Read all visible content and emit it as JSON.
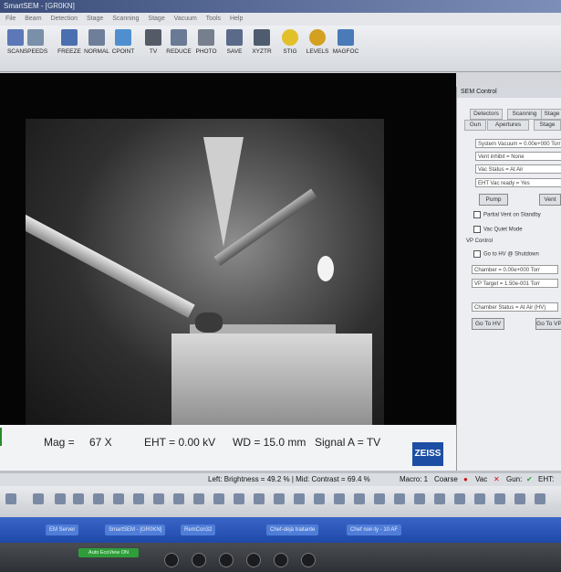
{
  "window": {
    "title": "SmartSEM - [GR0KN]"
  },
  "menu": [
    "File",
    "Beam",
    "Detection",
    "Stage",
    "Scanning",
    "Stage",
    "Vacuum",
    "Tools",
    "Help"
  ],
  "toolbar": [
    {
      "label": "SCAN",
      "icon": "scan-icon",
      "color": "#5c78b8"
    },
    {
      "label": "SPEEDS",
      "icon": "speeds-icon",
      "color": "#7a8fa8"
    },
    {
      "label": "FREEZE",
      "icon": "freeze-icon",
      "color": "#4a6fb0"
    },
    {
      "label": "NORMAL",
      "icon": "normal-icon",
      "color": "#6f7f9a"
    },
    {
      "label": "CPOINT",
      "icon": "cpoint-icon",
      "color": "#4f8fd0"
    },
    {
      "label": "TV",
      "icon": "tv-icon",
      "color": "#555b66"
    },
    {
      "label": "REDUCE",
      "icon": "reduce-icon",
      "color": "#6a7a94"
    },
    {
      "label": "PHOTO",
      "icon": "photo-icon",
      "color": "#777f8c"
    },
    {
      "label": "SAVE",
      "icon": "save-icon",
      "color": "#5a6a88"
    },
    {
      "label": "XYZTR",
      "icon": "xyztr-icon",
      "color": "#4f5b6e"
    },
    {
      "label": "STIG",
      "icon": "stig-icon",
      "color": "#e2c02a"
    },
    {
      "label": "LEVELS",
      "icon": "levels-icon",
      "color": "#d4a020"
    },
    {
      "label": "MAGFOC",
      "icon": "magfoc-icon",
      "color": "#4a7ab8"
    }
  ],
  "status": {
    "mag": "Mag =",
    "mag_value": "67 X",
    "eht": "EHT = 0.00 kV",
    "wd": "WD = 15.0 mm",
    "signal": "Signal A = TV",
    "brand": "ZEISS"
  },
  "panel": {
    "title": "SEM Control",
    "tabs_row1": [
      "Detectors",
      "Scanning",
      "Stage"
    ],
    "tabs_row2": [
      "Gun",
      "Apertures",
      "Stage"
    ],
    "system_vacuum": "System Vacuum = 0.00e+000 Torr",
    "vent_inhibit": "Vent inhibit = None",
    "vac_status": "Vac Status = At Air",
    "eht_vac_ready": "EHT Vac ready = Yes",
    "pump_label": "Pump",
    "vent_label": "Vent",
    "partial_vent": "Partial Vent on Standby",
    "vac_quiet": "Vac Quiet Mode",
    "vp_control": "VP Control",
    "go_hv_shutdown": "Go to HV @ Shutdown",
    "chamber": "Chamber = 0.00e+000 Torr",
    "vp_target": "VP Target = 1.50e-001 Torr",
    "chamber_status": "Chamber Status = At Air (HV)",
    "go_to_hv": "Go To HV",
    "go_to_vp": "Go To VP"
  },
  "brightness_bar": {
    "text": "Left: Brightness = 49.2 % | Mid: Contrast = 69.4 %",
    "macro": "Macro: 1",
    "coarse": "Coarse",
    "vac": "Vac",
    "gun": "Gun:",
    "eht": "EHT:"
  },
  "taskbar": [
    "EM Server",
    "SmartSEM - [GR0KN]",
    "RemCon32",
    "Chef-déjà traitante",
    "Chef noir-ty - 10 AF"
  ],
  "monitor": {
    "eco": "Auto EcoView ON"
  },
  "colors": {
    "accent_blue": "#1c4fa3",
    "green": "#2f9e3a",
    "red": "#cc1111"
  }
}
